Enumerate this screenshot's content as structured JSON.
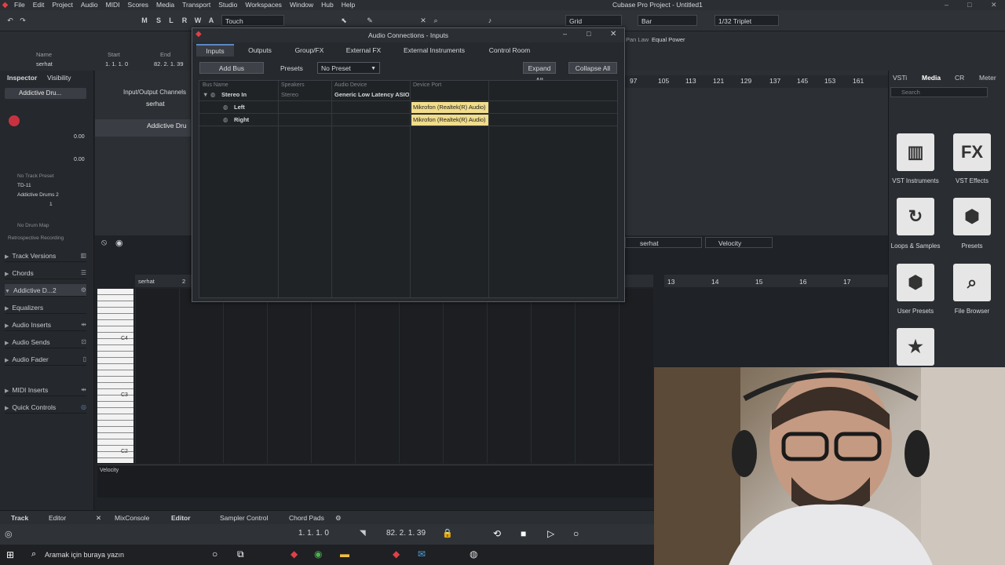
{
  "menu": {
    "items": [
      "File",
      "Edit",
      "Project",
      "Audio",
      "MIDI",
      "Scores",
      "Media",
      "Transport",
      "Studio",
      "Workspaces",
      "Window",
      "Hub",
      "Help"
    ],
    "window_title": "Cubase Pro Project - Untitled1"
  },
  "toolbar": {
    "m": "M",
    "s": "S",
    "l": "L",
    "r": "R",
    "w": "W",
    "a": "A",
    "automation_mode": "Touch",
    "grid_type": "Grid",
    "grid_unit": "Bar",
    "quantize": "1/32 Triplet"
  },
  "info_row": {
    "name_label": "Name",
    "name_value": "serhat",
    "start_label": "Start",
    "start_value": "1. 1. 1. 0",
    "end_label": "End",
    "end_value": "82. 2. 1. 39",
    "fade_label": "Pan Law",
    "fade_value": "Equal Power"
  },
  "inspector": {
    "tab_inspector": "Inspector",
    "tab_visibility": "Visibility",
    "track_name": "Addictive Dru...",
    "vol": "0.00",
    "pan": "0.00",
    "track_preset": "No Track Preset",
    "input": "TD-11",
    "output": "Addictive Drums 2",
    "channel": "1",
    "drum_map": "No Drum Map",
    "retro": "Retrospective Recording",
    "sections": [
      "Track Versions",
      "Chords",
      "Addictive D...2",
      "Equalizers",
      "Audio Inserts",
      "Audio Sends",
      "Audio Fader",
      "MIDI Inserts",
      "Quick Controls"
    ]
  },
  "tracks": {
    "folder": "Input/Output Channels",
    "track1": "serhat",
    "track2": "Addictive Dru"
  },
  "ruler": {
    "marks": [
      "97",
      "105",
      "113",
      "121",
      "129",
      "137",
      "145",
      "153",
      "161"
    ]
  },
  "editor": {
    "track": "serhat",
    "lane": "Velocity",
    "ruler_marks": [
      "13",
      "14",
      "15",
      "16",
      "17"
    ],
    "part_label": "serhat",
    "part_start": "2",
    "c4": "C4",
    "c3": "C3",
    "c2": "C2",
    "velocity_label": "Velocity"
  },
  "media": {
    "tabs": [
      "VSTi",
      "Media",
      "CR",
      "Meter"
    ],
    "search_placeholder": "Search",
    "tiles": [
      "VST Instruments",
      "VST Effects",
      "Loops & Samples",
      "Presets",
      "User Presets",
      "File Browser"
    ]
  },
  "bottom_tabs": [
    "Track",
    "Editor",
    "MixConsole",
    "Editor",
    "Sampler Control",
    "Chord Pads"
  ],
  "transport": {
    "left_locator": "1. 1. 1. 0",
    "right_locator": "82. 2. 1. 39"
  },
  "taskbar": {
    "search_placeholder": "Aramak için buraya yazın"
  },
  "dialog": {
    "title": "Audio Connections - Inputs",
    "tabs": [
      "Inputs",
      "Outputs",
      "Group/FX",
      "External FX",
      "External Instruments",
      "Control Room"
    ],
    "add_bus": "Add Bus",
    "presets_label": "Presets",
    "preset_value": "No Preset",
    "expand_all": "Expand All",
    "collapse_all": "Collapse All",
    "columns": [
      "Bus Name",
      "Speakers",
      "Audio Device",
      "Device Port"
    ],
    "rows": [
      {
        "name": "Stereo In",
        "speakers": "Stereo",
        "device": "Generic Low Latency ASIO D",
        "port": ""
      },
      {
        "name": "Left",
        "speakers": "",
        "device": "",
        "port": "Mikrofon (Realtek(R) Audio)"
      },
      {
        "name": "Right",
        "speakers": "",
        "device": "",
        "port": "Mikrofon (Realtek(R) Audio)"
      }
    ]
  },
  "colors": {
    "accent_red": "#e0404a",
    "accent_blue": "#5a88c4",
    "port_highlight": "#f1dd8b"
  }
}
